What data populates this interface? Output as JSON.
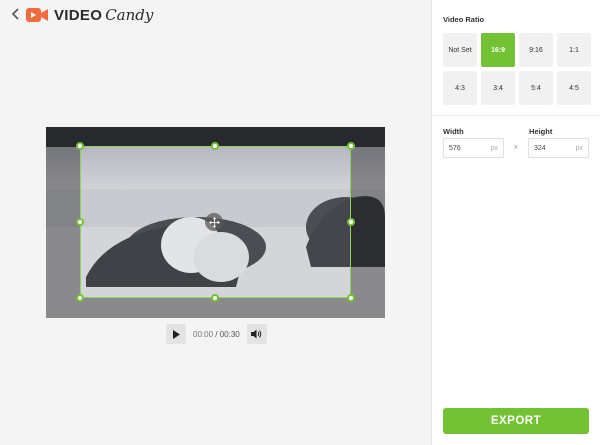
{
  "header": {
    "logo_video": "VIDEO",
    "logo_candy": "Candy"
  },
  "player": {
    "current_time": "00:00",
    "separator": "/",
    "total_time": "00:30"
  },
  "panel": {
    "ratio_title": "Video Ratio",
    "ratios": [
      {
        "label": "Not Set",
        "selected": false
      },
      {
        "label": "16:9",
        "selected": true
      },
      {
        "label": "9:16",
        "selected": false
      },
      {
        "label": "1:1",
        "selected": false
      },
      {
        "label": "4:3",
        "selected": false
      },
      {
        "label": "3:4",
        "selected": false
      },
      {
        "label": "5:4",
        "selected": false
      },
      {
        "label": "4:5",
        "selected": false
      }
    ],
    "width_label": "Width",
    "height_label": "Height",
    "width_value": "576",
    "height_value": "324",
    "unit": "px",
    "times": "x",
    "export_label": "EXPORT"
  },
  "colors": {
    "accent": "#72c234",
    "brand_orange": "#f26b3a"
  },
  "icons": {
    "back": "chevron-left-icon",
    "logo": "camera-icon",
    "play": "play-icon",
    "volume": "volume-icon",
    "move": "move-arrows-icon"
  }
}
